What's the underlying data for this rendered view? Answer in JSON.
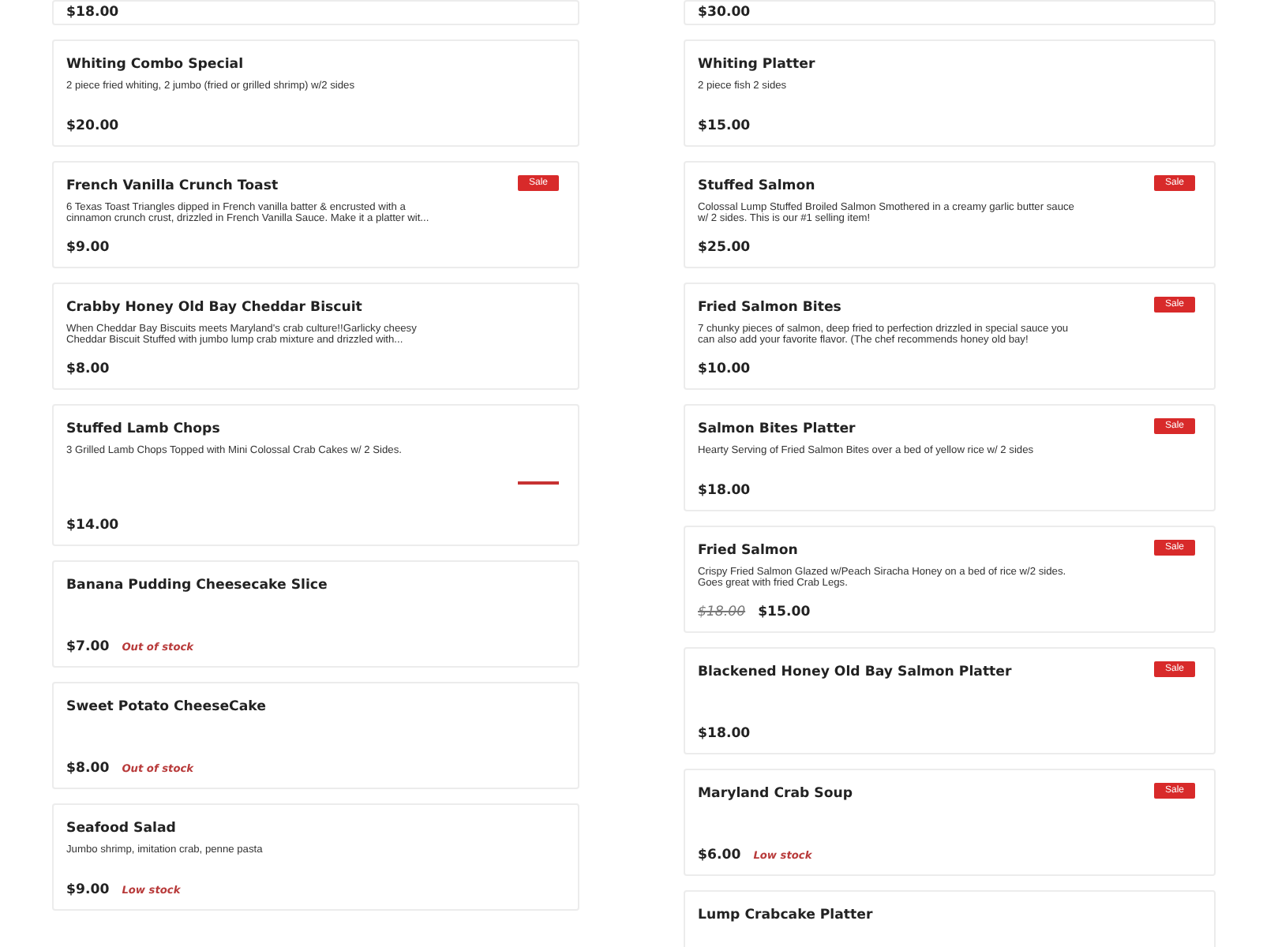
{
  "columns": [
    {
      "items": [
        {
          "price": "$18.00",
          "kind": "stub"
        },
        {
          "name": "Whiting Combo Special",
          "description": "2 piece fried whiting, 2 jumbo (fried or grilled shrimp) w/2 sides",
          "price": "$20.00"
        },
        {
          "name": "French Vanilla Crunch Toast",
          "description": "6 Texas Toast Triangles dipped in French vanilla batter & encrusted with a cinnamon crunch crust, drizzled in French Vanilla Sauce. Make it a platter wit...",
          "price": "$9.00",
          "badge": "Sale"
        },
        {
          "name": "Crabby Honey Old Bay Cheddar Biscuit",
          "description": "When Cheddar Bay Biscuits meets Maryland's crab culture!!Garlicky cheesy Cheddar Biscuit Stuffed with jumbo lump crab mixture and drizzled with...",
          "price": "$8.00"
        },
        {
          "name": "Stuffed Lamb Chops",
          "description": "3 Grilled Lamb Chops Topped with Mini Colossal Crab Cakes w/ 2 Sides.",
          "price": "$14.00",
          "sale_strip": true,
          "kind": "tall"
        },
        {
          "name": "Banana Pudding Cheesecake Slice",
          "price": "$7.00",
          "stock": "Out of stock"
        },
        {
          "name": "Sweet Potato CheeseCake",
          "price": "$8.00",
          "stock": "Out of stock"
        },
        {
          "name": "Seafood Salad",
          "description": "Jumbo shrimp, imitation crab, penne pasta",
          "price": "$9.00",
          "stock": "Low stock"
        }
      ]
    },
    {
      "items": [
        {
          "price": "$30.00",
          "kind": "stub"
        },
        {
          "name": "Whiting Platter",
          "description": "2 piece fish 2 sides",
          "price": "$15.00"
        },
        {
          "name": "Stuffed Salmon",
          "description": "Colossal Lump Stuffed Broiled Salmon Smothered in a creamy garlic butter sauce w/ 2 sides. This is our #1 selling item!",
          "price": "$25.00",
          "badge": "Sale"
        },
        {
          "name": "Fried Salmon Bites",
          "description": "7 chunky pieces of salmon, deep fried to perfection drizzled in special sauce you can also add your favorite flavor. (The chef recommends honey old bay!",
          "price": "$10.00",
          "badge": "Sale"
        },
        {
          "name": "Salmon Bites Platter",
          "description": "Hearty Serving of Fried Salmon Bites over a bed of yellow rice w/ 2 sides",
          "price": "$18.00",
          "badge": "Sale"
        },
        {
          "name": "Fried Salmon",
          "description": "Crispy Fried Salmon Glazed w/Peach Siracha Honey on a bed of rice w/2 sides. Goes great with fried Crab Legs.",
          "old_price": "$18.00",
          "price": "$15.00",
          "badge": "Sale"
        },
        {
          "name": "Blackened Honey Old Bay Salmon Platter",
          "price": "$18.00",
          "badge": "Sale"
        },
        {
          "name": "Maryland Crab Soup",
          "price": "$6.00",
          "stock": "Low stock",
          "badge": "Sale"
        },
        {
          "name": "Lump Crabcake Platter",
          "kind": "cut"
        }
      ]
    }
  ]
}
